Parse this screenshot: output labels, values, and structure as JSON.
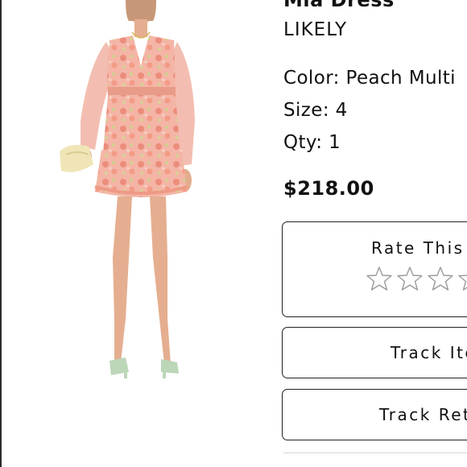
{
  "product": {
    "title": "Mia Dress",
    "brand": "LIKELY",
    "color": "Color: Peach Multi",
    "size": "Size: 4",
    "qty": "Qty: 1",
    "price": "$218.00"
  },
  "actions": {
    "rate_label": "Rate This",
    "track_item_label": "Track Item",
    "track_return_label": "Track Return"
  },
  "rating": {
    "max": 5,
    "value": 0
  },
  "icons": {
    "star": "star-outline-icon"
  },
  "colors": {
    "text": "#111111",
    "border": "#222222",
    "star_outline": "#9a9a9a",
    "dress_base": "#f3b2a4",
    "dress_pattern": "#e98a7b",
    "dress_accent": "#c9cf8a",
    "shoes": "#bcd6b8",
    "clutch": "#efe5b8",
    "skin": "#e8b291"
  }
}
